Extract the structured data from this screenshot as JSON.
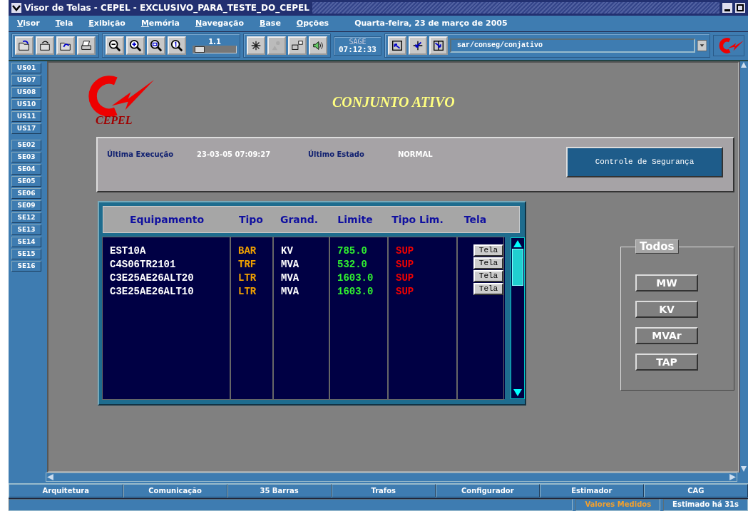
{
  "window": {
    "title": "Visor de Telas - CEPEL - EXCLUSIVO_PARA_TESTE_DO_CEPEL"
  },
  "menu": [
    "Visor",
    "Tela",
    "Exibição",
    "Memória",
    "Navegação",
    "Base",
    "Opções"
  ],
  "date": "Quarta-feira, 23 de março de 2005",
  "toolbar": {
    "zoom_value": "1.1",
    "zoom_slider": {
      "level": 0.15
    },
    "clock_label": "SAGE",
    "clock_time": "07:12:33",
    "path_field": "sar/conseg/conjativo"
  },
  "sidebar": {
    "groups": [
      [
        "US01",
        "US07",
        "US08",
        "US10",
        "US11",
        "US17"
      ],
      [
        "SE02",
        "SE03",
        "SE04",
        "SE05",
        "SE06",
        "SE09",
        "SE12",
        "SE13",
        "SE14",
        "SE15",
        "SE16"
      ]
    ]
  },
  "display": {
    "logo_text": "CEPEL",
    "title": "CONJUNTO ATIVO",
    "info": [
      {
        "label": "Última Execução",
        "value": "23-03-05 07:09:27"
      },
      {
        "label": "Último Estado",
        "value": "NORMAL"
      }
    ],
    "action_button": "Controle de Segurança",
    "table": {
      "columns": [
        "Equipamento",
        "Tipo",
        "Grand.",
        "Limite",
        "Tipo Lim.",
        "Tela"
      ],
      "rows": [
        {
          "cells": [
            "EST10A",
            "BAR",
            "KV",
            "785.0",
            "SUP"
          ],
          "button": "Tela"
        },
        {
          "cells": [
            "C4S06TR2101",
            "TRF",
            "MVA",
            "532.0",
            "SUP"
          ],
          "button": "Tela"
        },
        {
          "cells": [
            "C3E25AE26ALT20",
            "LTR",
            "MVA",
            "1603.0",
            "SUP"
          ],
          "button": "Tela"
        },
        {
          "cells": [
            "C3E25AE26ALT10",
            "LTR",
            "MVA",
            "1603.0",
            "SUP"
          ],
          "button": "Tela"
        }
      ]
    },
    "filter_group": {
      "title": "Todos",
      "buttons": [
        "MW",
        "KV",
        "MVAr",
        "TAP"
      ]
    }
  },
  "bottom_tabs": [
    "Arquitetura",
    "Comunicação",
    "35 Barras",
    "Trafos",
    "Configurador",
    "Estimador",
    "CAG"
  ],
  "status_bar": {
    "indicators": [
      {
        "text": "Valores Medidos",
        "color": "#f0a030"
      },
      {
        "text": "Estimado há 31s",
        "color": "#ffffff"
      }
    ]
  }
}
